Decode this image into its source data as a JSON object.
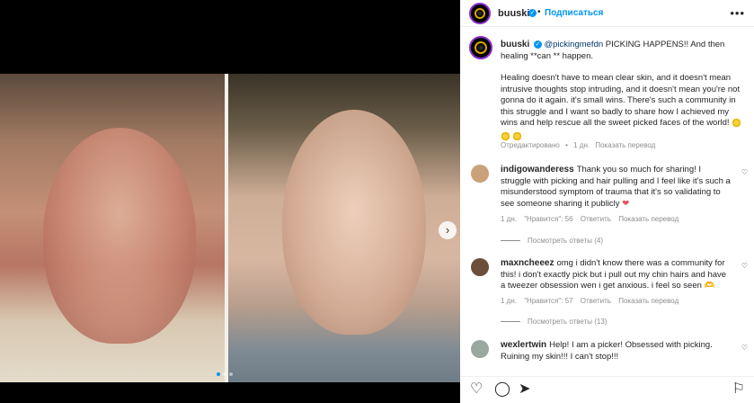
{
  "post": {
    "username": "buuski",
    "follow_label": "Подписаться",
    "separator": "•",
    "more_label": "•••",
    "verified_mark": "✓"
  },
  "caption": {
    "username": "buuski",
    "mention": "@pickingmefdn",
    "line1": "PICKING HAPPENS!! And then healing **can ** happen.",
    "paragraph": "Healing doesn't have to mean clear skin, and it doesn't mean intrusive thoughts stop intruding, and it doesn't mean you're not gonna do it again. it's small wins. There's such a community in this struggle and I want so badly to share how I achieved my wins and help rescue all the sweet picked faces of the world!",
    "edited": "Отредактировано",
    "age": "1 дн.",
    "translate": "Показать перевод"
  },
  "comments": [
    {
      "username": "indigowanderess",
      "text": "Thank you so much for sharing! I struggle with picking and hair pulling and I feel like it's such a misunderstood symptom of trauma that it's so validating to see someone sharing it publicly",
      "heart_emoji": "❤",
      "age": "1 дн.",
      "likes": "\"Нравится\": 56",
      "reply": "Ответить",
      "translate": "Показать перевод",
      "view_replies": "Посмотреть ответы (4)",
      "avatar_color": "#c9a27a"
    },
    {
      "username": "maxncheeez",
      "text": "omg i didn't know there was a community for this! i don't exactly pick but i pull out my chin hairs and have a tweezer obsession wen i get anxious. i feel so seen 🫶",
      "age": "1 дн.",
      "likes": "\"Нравится\": 57",
      "reply": "Ответить",
      "translate": "Показать перевод",
      "view_replies": "Посмотреть ответы (13)",
      "avatar_color": "#6b4f3a"
    },
    {
      "username": "wexlertwin",
      "text": "Help! I am a picker! Obsessed with picking. Ruining my skin!!! I can't stop!!!",
      "avatar_color": "#9aa8a0"
    }
  ],
  "icons": {
    "heart": "♡",
    "comment": "◯",
    "share": "➤",
    "save": "⚐",
    "next": "›"
  }
}
